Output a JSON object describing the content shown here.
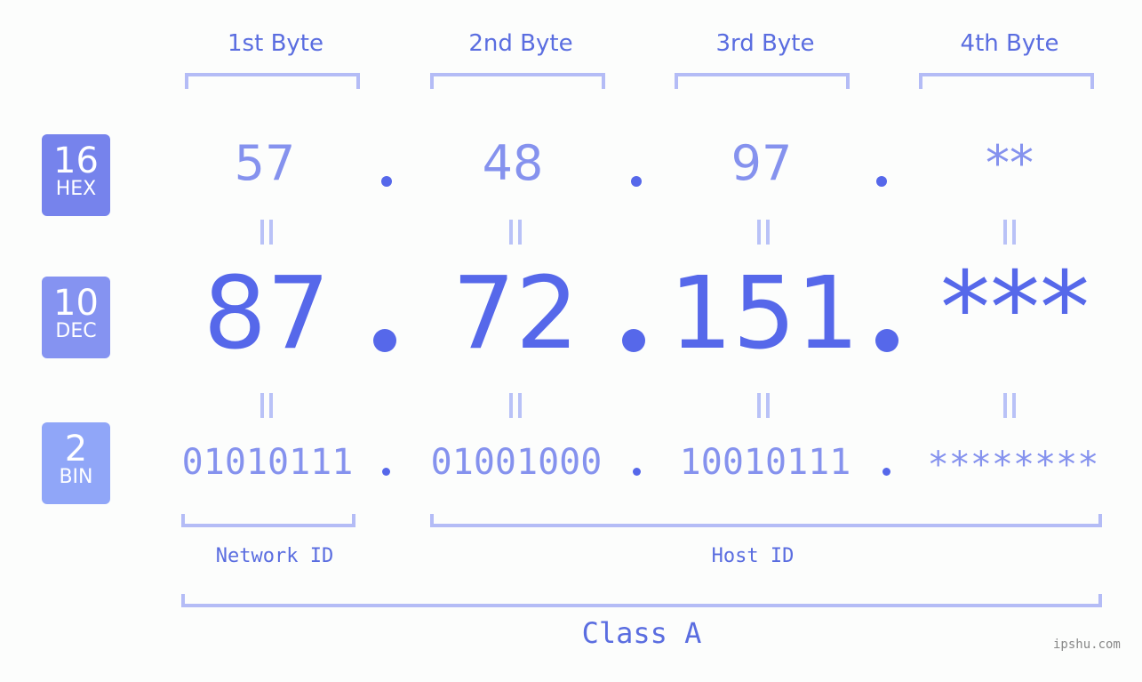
{
  "bytes": [
    {
      "header": "1st Byte",
      "hex": "57",
      "dec": "87",
      "bin": "01010111"
    },
    {
      "header": "2nd Byte",
      "hex": "48",
      "dec": "72",
      "bin": "01001000"
    },
    {
      "header": "3rd Byte",
      "hex": "97",
      "dec": "151",
      "bin": "10010111"
    },
    {
      "header": "4th Byte",
      "hex": "**",
      "dec": "***",
      "bin": "********"
    }
  ],
  "badges": {
    "hex": {
      "base": "16",
      "label": "HEX",
      "color": "#7683ec"
    },
    "dec": {
      "base": "10",
      "label": "DEC",
      "color": "#8593f1"
    },
    "bin": {
      "base": "2",
      "label": "BIN",
      "color": "#90a6f8"
    }
  },
  "labels": {
    "network_id": "Network ID",
    "host_id": "Host ID",
    "class": "Class A"
  },
  "watermark": "ipshu.com",
  "colors": {
    "accent": "#5668ea",
    "light_accent": "#8592ee",
    "bracket": "#b4bcf6"
  }
}
